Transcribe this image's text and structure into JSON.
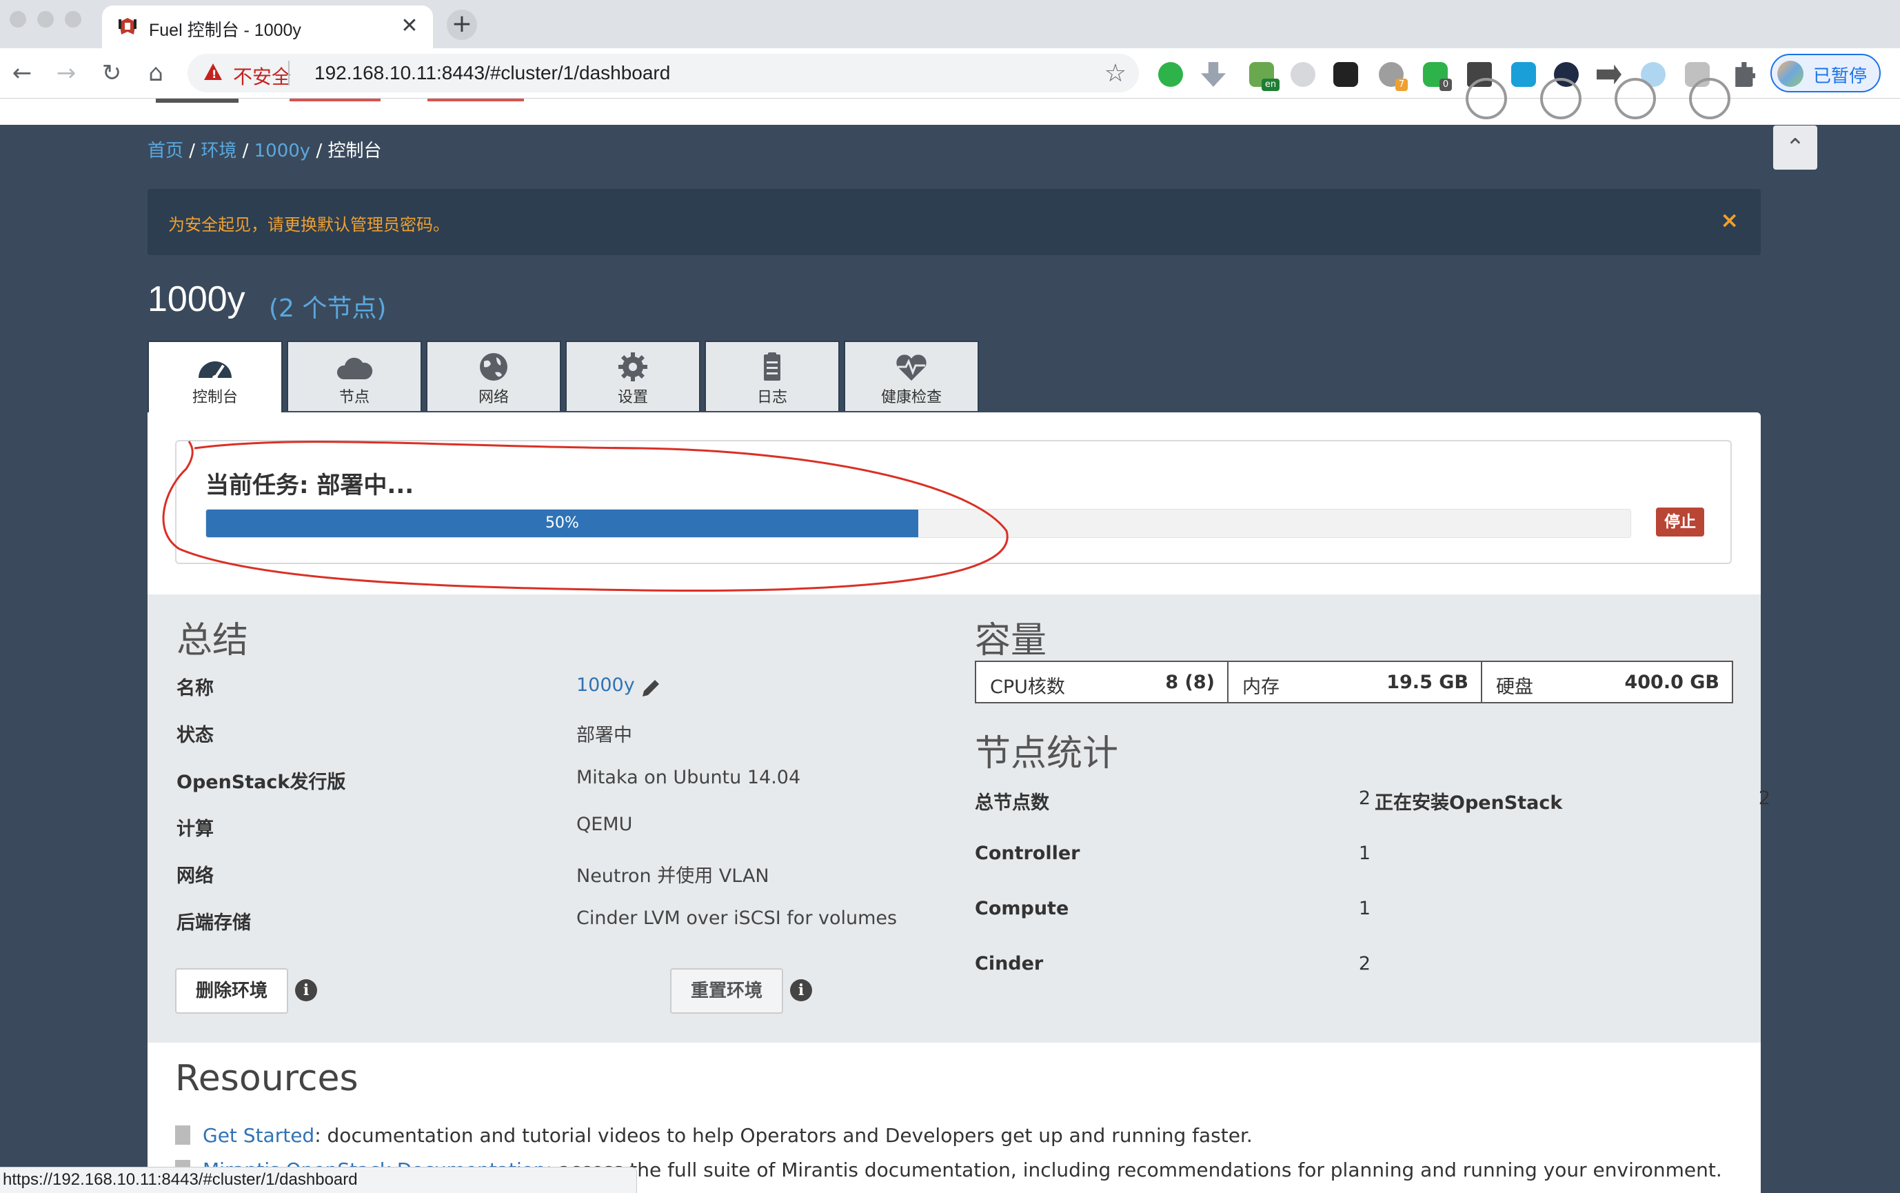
{
  "browser": {
    "tab_title": "Fuel 控制台 - 1000y",
    "security_label": "不安全",
    "url": "192.168.10.11:8443/#cluster/1/dashboard",
    "profile_label": "已暂停",
    "extension_badges": {
      "ext6": "7",
      "ext7": "0"
    },
    "status_url": "https://192.168.10.11:8443/#cluster/1/dashboard"
  },
  "breadcrumb": {
    "home": "首页",
    "envs": "环境",
    "env": "1000y",
    "current": "控制台",
    "sep": "/"
  },
  "alert": {
    "text": "为安全起见，请更换默认管理员密码。",
    "close": "×"
  },
  "env": {
    "name": "1000y",
    "node_count": "(2 个节点)"
  },
  "tabs": [
    {
      "label": "控制台",
      "icon": "dashboard-gauge-icon"
    },
    {
      "label": "节点",
      "icon": "cloud-icon"
    },
    {
      "label": "网络",
      "icon": "globe-icon"
    },
    {
      "label": "设置",
      "icon": "gear-icon"
    },
    {
      "label": "日志",
      "icon": "clipboard-icon"
    },
    {
      "label": "健康检查",
      "icon": "heartbeat-icon"
    }
  ],
  "task": {
    "title": "当前任务: 部署中...",
    "progress_label": "50%",
    "progress": 0.5,
    "stop_label": "停止"
  },
  "summary": {
    "title": "总结",
    "rows": [
      {
        "label": "名称",
        "value": "1000y"
      },
      {
        "label": "状态",
        "value": "部署中"
      },
      {
        "label": "OpenStack发行版",
        "value": "Mitaka on Ubuntu 14.04"
      },
      {
        "label": "计算",
        "value": "QEMU"
      },
      {
        "label": "网络",
        "value": "Neutron 并使用 VLAN"
      },
      {
        "label": "后端存储",
        "value": "Cinder LVM over iSCSI for volumes"
      }
    ],
    "delete_label": "删除环境",
    "reset_label": "重置环境",
    "info": "i"
  },
  "capacity": {
    "title": "容量",
    "cells": [
      {
        "label": "CPU核数",
        "value": "8 (8)"
      },
      {
        "label": "内存",
        "value": "19.5 GB"
      },
      {
        "label": "硬盘",
        "value": "400.0 GB"
      }
    ]
  },
  "node_stats": {
    "title": "节点统计",
    "rows": [
      {
        "label": "总节点数",
        "value": "2"
      },
      {
        "label": "Controller",
        "value": "1"
      },
      {
        "label": "Compute",
        "value": "1"
      },
      {
        "label": "Cinder",
        "value": "2"
      }
    ],
    "installing": {
      "label": "正在安装OpenStack",
      "value": "2"
    }
  },
  "resources": {
    "title": "Resources",
    "items": [
      {
        "link": "Get Started",
        "text": ": documentation and tutorial videos to help Operators and Developers get up and running faster."
      },
      {
        "link": "Mirantis OpenStack Documentation",
        "text": ": access the full suite of Mirantis documentation, including recommendations for planning and running your environment."
      }
    ]
  },
  "colors": {
    "page_bg": "#3a4a5c",
    "accent": "#2f73b6",
    "alert_text": "#f0a030",
    "danger": "#b94535",
    "annotation": "#d93025"
  }
}
